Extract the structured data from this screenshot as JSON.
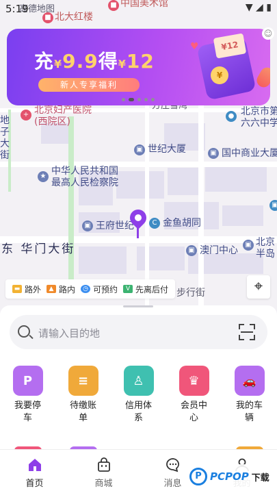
{
  "status_bar": {
    "time": "5:19",
    "icons": [
      "wifi-icon",
      "signal-icon",
      "battery-icon"
    ]
  },
  "map": {
    "labels": {
      "top_left": "高德地图",
      "hongloup": "北大红楼",
      "art_museum": "中国美术馆",
      "fuchan": "北京妇产医院",
      "fuchan_sub": "(西院区)",
      "fangzhu": "方庄雪湾",
      "beijing_di": "北京市第",
      "liushi": "六六中学",
      "shiji": "世纪大厦",
      "guozhong": "国中商业大厦",
      "jianchayuan_1": "中华人民共和国",
      "jianchayuan_2": "最高人民检察院",
      "wangfu": "王府世纪",
      "jinyu": "金鱼胡同",
      "donghuamen": "东 华门大街",
      "aomen": "澳门中心",
      "beijing_r": "北京",
      "bandao": "半岛",
      "buxingjie": "步行街",
      "left_vertical": "地\n子\n大\n街"
    }
  },
  "banner": {
    "prefix": "充",
    "currency": "¥",
    "amount_1": "9.9",
    "middle": "得",
    "amount_2": "12",
    "tag": "新人专享福利",
    "card_text": "¥12",
    "coin_text": "¥"
  },
  "legend": [
    {
      "label": "路外",
      "color": "#f2b233"
    },
    {
      "label": "路内",
      "color": "#f08a2b"
    },
    {
      "label": "可预约",
      "color": "#3b8ef0"
    },
    {
      "label": "先离后付",
      "color": "#3cb371"
    }
  ],
  "search": {
    "placeholder": "请输入目的地"
  },
  "features": [
    {
      "label": "我要停车",
      "icon": "parking-icon",
      "glyph": "P",
      "color": "#b46ef0"
    },
    {
      "label": "待缴账单",
      "icon": "bill-icon",
      "glyph": "≡",
      "color": "#f0a93a"
    },
    {
      "label": "信用体系",
      "icon": "shield-user-icon",
      "glyph": "♙",
      "color": "#3fc0b0"
    },
    {
      "label": "会员中心",
      "icon": "crown-icon",
      "glyph": "♛",
      "color": "#f0567a"
    },
    {
      "label": "我的车辆",
      "icon": "car-icon",
      "glyph": "🚗",
      "color": "#b46ef0"
    }
  ],
  "tabs": [
    {
      "label": "首页",
      "icon": "home-icon",
      "active": true
    },
    {
      "label": "商城",
      "icon": "shopping-bag-icon",
      "active": false
    },
    {
      "label": "消息",
      "icon": "message-icon",
      "active": false
    },
    {
      "label": "我的",
      "icon": "profile-icon",
      "active": false
    }
  ],
  "watermark": {
    "logo": "P",
    "text": "PCPOP",
    "sub": "下载"
  },
  "colors": {
    "accent": "#8e3fe8",
    "banner_start": "#7a3ff0",
    "banner_end": "#d86bf0"
  }
}
